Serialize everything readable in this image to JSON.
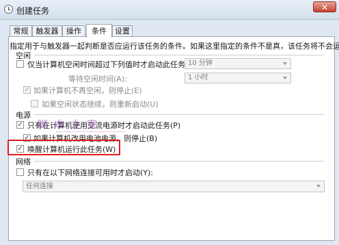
{
  "window": {
    "title": "创建任务",
    "close_label": "✕",
    "icon": "clock-icon"
  },
  "tabs": [
    {
      "label": "常规",
      "active": false
    },
    {
      "label": "触发器",
      "active": false
    },
    {
      "label": "操作",
      "active": false
    },
    {
      "label": "条件",
      "active": true
    },
    {
      "label": "设置",
      "active": false
    }
  ],
  "description": "指定用于与触发器一起判断是否应运行该任务的条件。如果这里指定的条件不是真，该任务将不会运行。",
  "idle": {
    "section": "空闲",
    "start_if_idle": {
      "label": "仅当计算机空闲时间超过下列值时才启动此任务(C):",
      "checked": false
    },
    "idle_duration": "10 分钟",
    "wait_label": "等待空闲时间(A):",
    "wait_value": "1 小时",
    "stop_if_not_idle": {
      "label": "如果计算机不再空闲，则停止(E)",
      "checked": true,
      "disabled": true
    },
    "restart_if_idle": {
      "label": "如果空闲状态继续，则重新启动(U)",
      "checked": false,
      "disabled": true
    }
  },
  "power": {
    "section": "电源",
    "ac_only": {
      "label": "只有在计算机使用交流电源时才启动此任务(P)",
      "checked": true
    },
    "stop_on_battery": {
      "label": "如果计算机改用电池电源，则停止(B)",
      "checked": true
    },
    "wake": {
      "label": "唤醒计算机运行此任务(W)",
      "checked": true
    }
  },
  "network": {
    "section": "网络",
    "start_if_network": {
      "label": "只有在以下网络连接可用时才启动(Y):",
      "checked": false
    },
    "connection": "任何连接"
  },
  "watermark": "脚本之家",
  "colors": {
    "highlight": "#e21b1b",
    "close": "#c7402c"
  }
}
